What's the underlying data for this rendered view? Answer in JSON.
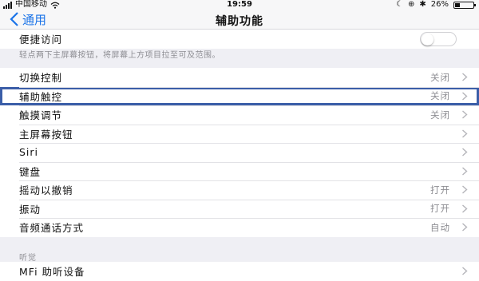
{
  "status_bar": {
    "carrier": "中国移动",
    "time": "19:59",
    "battery": "26%",
    "battery_level": 0.26
  },
  "nav": {
    "back_label": "通用",
    "title": "辅助功能"
  },
  "shortcut": {
    "label": "便捷访问",
    "enabled": false,
    "footnote": "轻点两下主屏幕按钮，将屏幕上方项目拉至可及范围。"
  },
  "items": [
    {
      "label": "切换控制",
      "value": "关闭"
    },
    {
      "label": "辅助触控",
      "value": "关闭",
      "highlighted": true
    },
    {
      "label": "触摸调节",
      "value": "关闭"
    },
    {
      "label": "主屏幕按钮",
      "value": ""
    },
    {
      "label": "Siri",
      "value": ""
    },
    {
      "label": "键盘",
      "value": ""
    },
    {
      "label": "摇动以撤销",
      "value": "打开"
    },
    {
      "label": "振动",
      "value": "打开"
    },
    {
      "label": "音频通话方式",
      "value": "自动"
    }
  ],
  "hearing": {
    "header": "听觉",
    "items": [
      {
        "label": "MFi 助听设备",
        "value": ""
      }
    ]
  },
  "colors": {
    "accent": "#1a73e8",
    "highlight_border": "#3b5ea8",
    "background": "#efeff4",
    "secondary_text": "#8e8e93"
  }
}
